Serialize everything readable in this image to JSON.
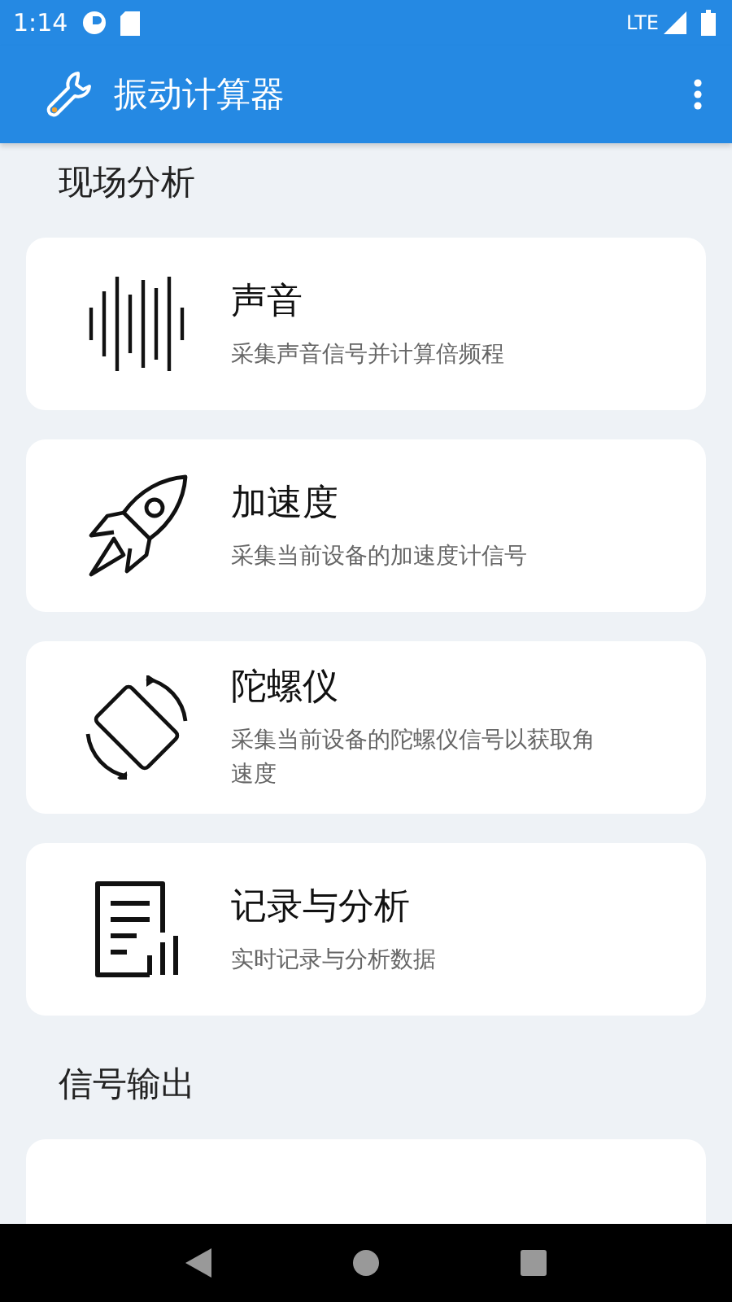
{
  "status_bar": {
    "time": "1:14",
    "network": "LTE"
  },
  "app_bar": {
    "title": "振动计算器"
  },
  "sections": [
    {
      "title": "现场分析",
      "items": [
        {
          "kind": "sound",
          "title": "声音",
          "subtitle": "采集声音信号并计算倍频程"
        },
        {
          "kind": "rocket",
          "title": "加速度",
          "subtitle": "采集当前设备的加速度计信号"
        },
        {
          "kind": "rotate",
          "title": "陀螺仪",
          "subtitle": "采集当前设备的陀螺仪信号以获取角速度"
        },
        {
          "kind": "record",
          "title": "记录与分析",
          "subtitle": "实时记录与分析数据"
        }
      ]
    },
    {
      "title": "信号输出",
      "items": [
        {
          "kind": "partial"
        }
      ]
    }
  ]
}
